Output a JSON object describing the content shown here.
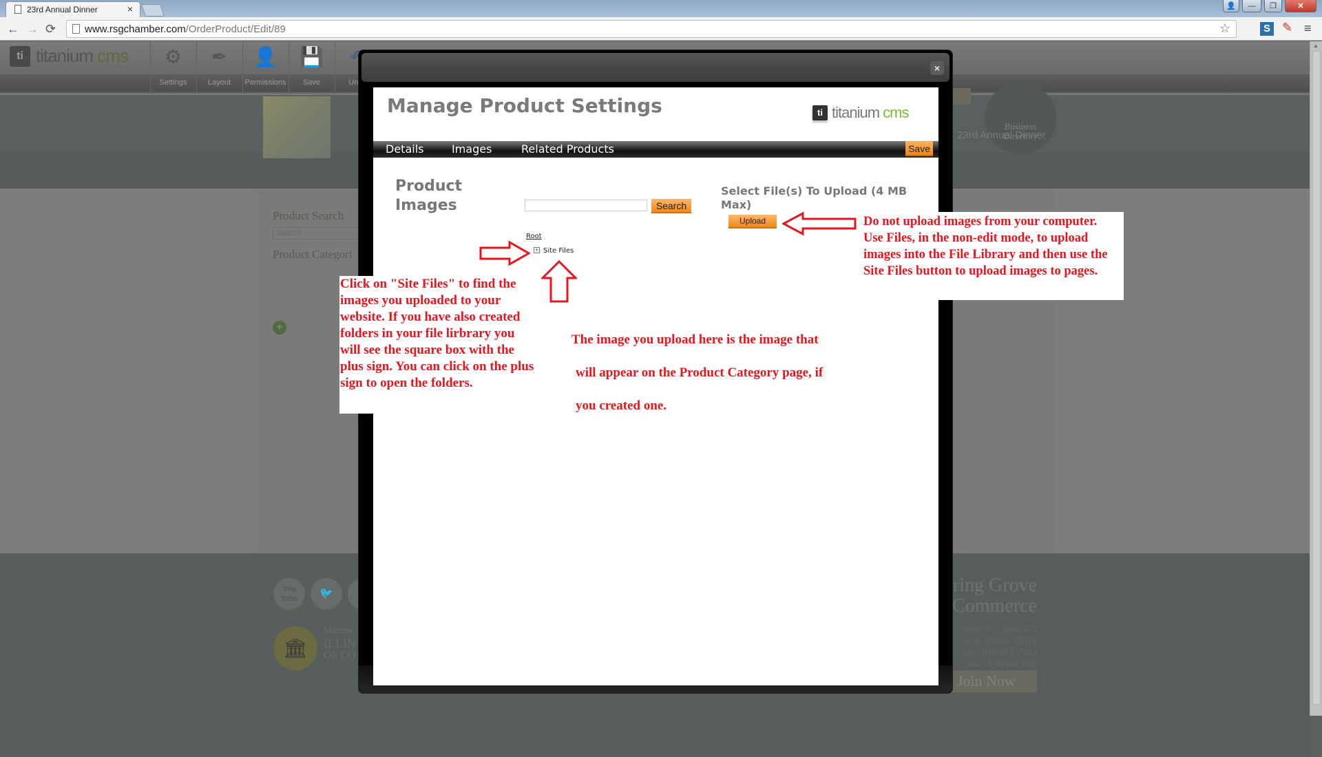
{
  "browser": {
    "tab_title": "23rd Annual Dinner",
    "tab_close": "×",
    "url_host": "www.rsgchamber.com",
    "url_path": "/OrderProduct/Edit/89",
    "icons": {
      "back": "←",
      "forward": "→",
      "reload": "⟳",
      "bookmark_star": "☆",
      "menu": "≡",
      "extension_s": "S",
      "eyedropper": "✎"
    },
    "window_controls": {
      "user": "👤",
      "minimize": "—",
      "maximize": "❐",
      "close": "✕"
    }
  },
  "cms_toolbar": {
    "logo_text": "titanium",
    "logo_cms": "cms",
    "logo_badge": "ti",
    "tools": [
      {
        "label": "Settings",
        "icon": "⚙"
      },
      {
        "label": "Layout",
        "icon": "✒"
      },
      {
        "label": "Permissions",
        "icon": "👤"
      },
      {
        "label": "Save",
        "icon": "💾"
      },
      {
        "label": "Undo",
        "icon": "↶"
      },
      {
        "label": "",
        "icon": "↷"
      },
      {
        "label": "",
        "icon": "●"
      }
    ]
  },
  "background_page": {
    "business_directory_line1": "Business",
    "business_directory_line2": "Directory",
    "breadcrumb_title": "23rd Annual Dinner",
    "product_search_title": "Product Search",
    "product_search_placeholder": "Search",
    "product_categories_title": "Product Categori",
    "add_icon": "+",
    "footer": {
      "social": [
        "You Tube",
        "🐦",
        ""
      ],
      "member_line1": "Membe",
      "member_line2": "ILLIN",
      "member_line3": "OF CO",
      "org_line1": "ring Grove",
      "org_line2": "Commerce",
      "address_lines": [
        "treet, P.O. Box 475",
        "ond, Illinois 60071",
        "one: 815-678-7742",
        "):00 am - 5:00 pm"
      ],
      "join_button": "Join Now",
      "seal_icon": "🏛"
    }
  },
  "modal": {
    "close_label": "×",
    "title": "Manage Product Settings",
    "logo_badge": "ti",
    "logo_text": "titanium",
    "logo_cms": "cms",
    "tabs": [
      "Details",
      "Images",
      "Related Products"
    ],
    "save_label": "Save",
    "product_images_title_line1": "Product",
    "product_images_title_line2": "Images",
    "search_value": "",
    "search_button": "Search",
    "tree_root": "Root",
    "tree_plus": "+",
    "tree_item": "Site Files",
    "upload_title": "Select File(s) To Upload (4 MB Max)",
    "upload_button": "Upload"
  },
  "annotations": {
    "right_note": "Do not upload images from your computer. Use Files, in the non-edit mode, to upload images into the File Library and then use the Site Files button to upload images to pages.",
    "left_note": "Click on \"Site Files\" to find the images you uploaded to your website. If you have also created folders in your file lirbrary you will see the square box with the plus sign. You can click on the plus sign to open the folders.",
    "center_line1": "The image you upload here is the image that",
    "center_line2": "will appear on the Product Category page, if",
    "center_line3": "you created one.",
    "annotation_color": "#e8151f"
  }
}
